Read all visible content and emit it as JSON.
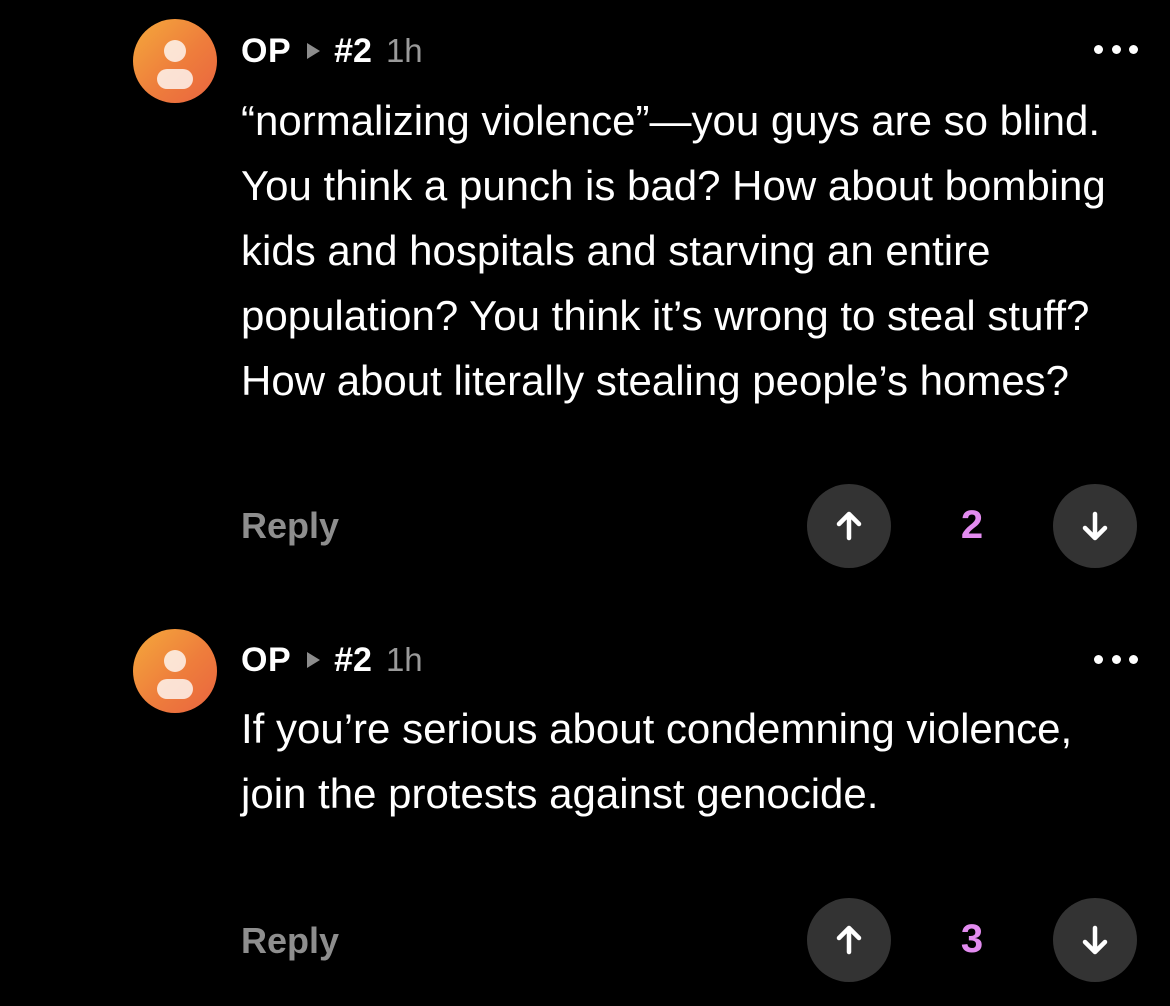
{
  "theme": {
    "background": "#000000",
    "text": "#ffffff",
    "muted": "#8e8e8e",
    "vote_count_color": "#e38cf0",
    "button_bg": "#333333",
    "avatar_gradient": [
      "#f4a93b",
      "#e9643f"
    ]
  },
  "comments": [
    {
      "author": "OP",
      "thread": "#2",
      "time": "1h",
      "text": "“normalizing violence”—you guys are so blind. You think a punch is bad? How about bombing kids and hospitals and starving an entire population? You think it’s wrong to steal stuff? How about literally stealing people’s homes?",
      "reply_label": "Reply",
      "votes": "2",
      "icons": {
        "avatar": "person-avatar-icon",
        "upvote": "arrow-up-icon",
        "downvote": "arrow-down-icon",
        "more": "more-dots-icon",
        "play": "play-triangle-icon"
      }
    },
    {
      "author": "OP",
      "thread": "#2",
      "time": "1h",
      "text": "If you’re serious about condemning violence, join the protests against genocide.",
      "reply_label": "Reply",
      "votes": "3",
      "icons": {
        "avatar": "person-avatar-icon",
        "upvote": "arrow-up-icon",
        "downvote": "arrow-down-icon",
        "more": "more-dots-icon",
        "play": "play-triangle-icon"
      }
    }
  ]
}
